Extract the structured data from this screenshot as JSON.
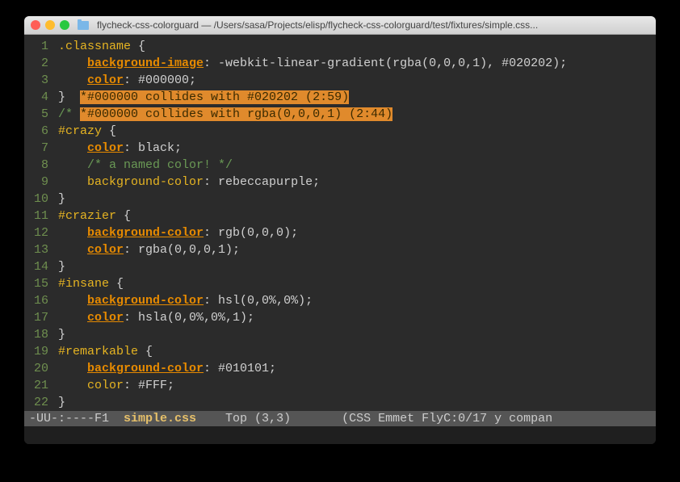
{
  "titlebar": {
    "title": "flycheck-css-colorguard — /Users/sasa/Projects/elisp/flycheck-css-colorguard/test/fixtures/simple.css..."
  },
  "lines": [
    {
      "num": "1",
      "segments": [
        {
          "cls": "tok-selector",
          "text": ".classname"
        },
        {
          "cls": "",
          "text": " {"
        }
      ]
    },
    {
      "num": "2",
      "segments": [
        {
          "cls": "",
          "text": "    "
        },
        {
          "cls": "tok-prop",
          "text": "background-image"
        },
        {
          "cls": "",
          "text": ": -webkit-linear-gradient(rgba(0,0,0,1), #020202);"
        }
      ]
    },
    {
      "num": "3",
      "segments": [
        {
          "cls": "",
          "text": "    "
        },
        {
          "cls": "tok-prop",
          "text": "color"
        },
        {
          "cls": "",
          "text": ": #000000;"
        }
      ]
    },
    {
      "num": "4",
      "segments": [
        {
          "cls": "",
          "text": "}  "
        },
        {
          "cls": "tok-warn-hi",
          "text": "*#000000 collides with #020202 (2:59)"
        }
      ]
    },
    {
      "num": "5",
      "segments": [
        {
          "cls": "tok-comment",
          "text": "/* "
        },
        {
          "cls": "tok-warn-hi",
          "text": "*#000000 collides with rgba(0,0,0,1) (2:44)"
        }
      ]
    },
    {
      "num": "6",
      "segments": [
        {
          "cls": "tok-selector",
          "text": "#crazy"
        },
        {
          "cls": "",
          "text": " {"
        }
      ]
    },
    {
      "num": "7",
      "segments": [
        {
          "cls": "",
          "text": "    "
        },
        {
          "cls": "tok-prop",
          "text": "color"
        },
        {
          "cls": "",
          "text": ": black;"
        }
      ]
    },
    {
      "num": "8",
      "segments": [
        {
          "cls": "",
          "text": "    "
        },
        {
          "cls": "tok-comment",
          "text": "/* a named color! */"
        }
      ]
    },
    {
      "num": "9",
      "segments": [
        {
          "cls": "",
          "text": "    "
        },
        {
          "cls": "tok-prop-plain",
          "text": "background-color"
        },
        {
          "cls": "",
          "text": ": rebeccapurple;"
        }
      ]
    },
    {
      "num": "10",
      "segments": [
        {
          "cls": "",
          "text": "}"
        }
      ]
    },
    {
      "num": "11",
      "segments": [
        {
          "cls": "tok-selector",
          "text": "#crazier"
        },
        {
          "cls": "",
          "text": " {"
        }
      ]
    },
    {
      "num": "12",
      "segments": [
        {
          "cls": "",
          "text": "    "
        },
        {
          "cls": "tok-prop",
          "text": "background-color"
        },
        {
          "cls": "",
          "text": ": rgb(0,0,0);"
        }
      ]
    },
    {
      "num": "13",
      "segments": [
        {
          "cls": "",
          "text": "    "
        },
        {
          "cls": "tok-prop",
          "text": "color"
        },
        {
          "cls": "",
          "text": ": rgba(0,0,0,1);"
        }
      ]
    },
    {
      "num": "14",
      "segments": [
        {
          "cls": "",
          "text": "}"
        }
      ]
    },
    {
      "num": "15",
      "segments": [
        {
          "cls": "tok-selector",
          "text": "#insane"
        },
        {
          "cls": "",
          "text": " {"
        }
      ]
    },
    {
      "num": "16",
      "segments": [
        {
          "cls": "",
          "text": "    "
        },
        {
          "cls": "tok-prop",
          "text": "background-color"
        },
        {
          "cls": "",
          "text": ": hsl(0,0%,0%);"
        }
      ]
    },
    {
      "num": "17",
      "segments": [
        {
          "cls": "",
          "text": "    "
        },
        {
          "cls": "tok-prop",
          "text": "color"
        },
        {
          "cls": "",
          "text": ": hsla(0,0%,0%,1);"
        }
      ]
    },
    {
      "num": "18",
      "segments": [
        {
          "cls": "",
          "text": "}"
        }
      ]
    },
    {
      "num": "19",
      "segments": [
        {
          "cls": "tok-selector",
          "text": "#remarkable"
        },
        {
          "cls": "",
          "text": " {"
        }
      ]
    },
    {
      "num": "20",
      "segments": [
        {
          "cls": "",
          "text": "    "
        },
        {
          "cls": "tok-prop",
          "text": "background-color"
        },
        {
          "cls": "",
          "text": ": #010101;"
        }
      ]
    },
    {
      "num": "21",
      "segments": [
        {
          "cls": "",
          "text": "    "
        },
        {
          "cls": "tok-prop-plain",
          "text": "color"
        },
        {
          "cls": "",
          "text": ": #FFF;"
        }
      ]
    },
    {
      "num": "22",
      "segments": [
        {
          "cls": "",
          "text": "}"
        }
      ]
    }
  ],
  "modeline": {
    "left": "-UU-:----F1  ",
    "filename": "simple.css",
    "pos": "    Top (3,3)       ",
    "right": "(CSS Emmet FlyC:0/17 y compan"
  }
}
